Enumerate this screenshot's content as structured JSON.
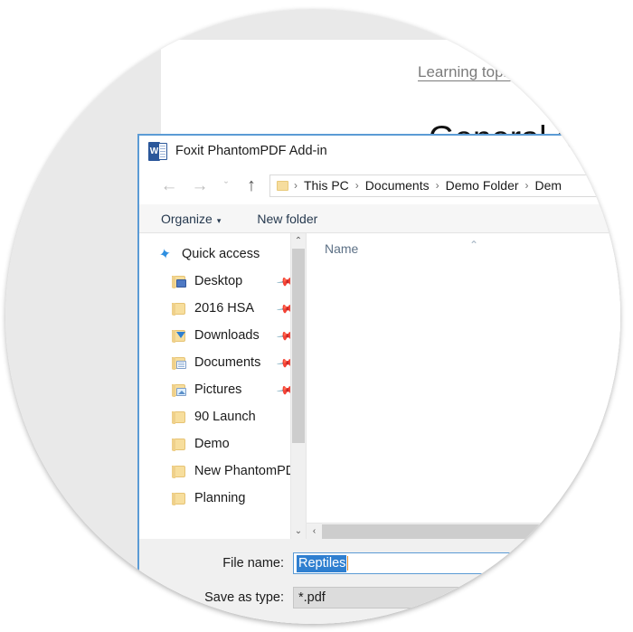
{
  "document_behind": {
    "header_text": "Learning topic: Provide a",
    "title_text": "General charact"
  },
  "dialog": {
    "icon": "word-icon",
    "title": "Foxit PhantomPDF Add-in",
    "nav": {
      "back_icon": "back-arrow-icon",
      "back_glyph": "←",
      "forward_icon": "forward-arrow-icon",
      "forward_glyph": "→",
      "recent_icon": "chevron-down-icon",
      "recent_glyph": "ˇ",
      "up_icon": "up-arrow-icon",
      "up_glyph": "↑"
    },
    "address": {
      "folder_icon": "folder-icon",
      "crumbs": [
        "This PC",
        "Documents",
        "Demo Folder",
        "Dem"
      ],
      "separator": "›"
    },
    "toolbar": {
      "organize_label": "Organize",
      "organize_caret": "▾",
      "new_folder_label": "New folder"
    },
    "nav_pane": {
      "items": [
        {
          "label": "Quick access",
          "icon": "star-icon",
          "indent": "root",
          "pinned": false
        },
        {
          "label": "Desktop",
          "icon": "desktop-icon",
          "indent": "child",
          "pinned": true
        },
        {
          "label": "2016 HSA",
          "icon": "folder-icon",
          "indent": "child",
          "pinned": true
        },
        {
          "label": "Downloads",
          "icon": "downloads-icon",
          "indent": "child",
          "pinned": true
        },
        {
          "label": "Documents",
          "icon": "documents-icon",
          "indent": "child",
          "pinned": true
        },
        {
          "label": "Pictures",
          "icon": "pictures-icon",
          "indent": "child",
          "pinned": true
        },
        {
          "label": "90 Launch",
          "icon": "folder-icon",
          "indent": "child",
          "pinned": false
        },
        {
          "label": "Demo",
          "icon": "folder-icon",
          "indent": "child",
          "pinned": false
        },
        {
          "label": "New PhantomPD",
          "icon": "folder-icon",
          "indent": "child",
          "pinned": false
        },
        {
          "label": "Planning",
          "icon": "folder-icon",
          "indent": "child",
          "pinned": false
        }
      ],
      "scroll_up_glyph": "⌃",
      "scroll_down_glyph": "⌄"
    },
    "file_list": {
      "column_header": "Name",
      "sort_glyph": "⌃",
      "rows": [],
      "hscroll_left_glyph": "‹"
    },
    "footer": {
      "file_name_label": "File name:",
      "file_name_value": "Reptiles",
      "save_as_type_label": "Save as type:",
      "save_as_type_value": "*.pdf"
    }
  },
  "colors": {
    "accent_blue": "#5b9bd5",
    "selection_blue": "#2f7fd0",
    "word_blue": "#2b579a",
    "folder_yellow": "#f7de9d"
  }
}
